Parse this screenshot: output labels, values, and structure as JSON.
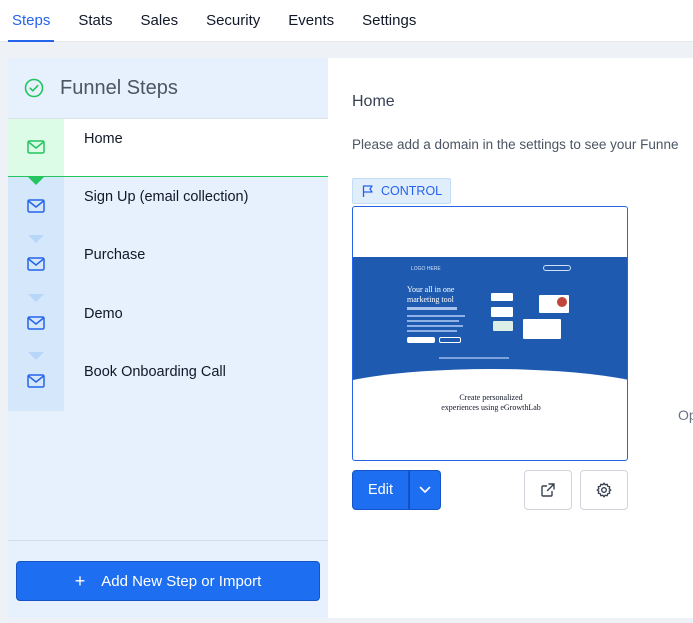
{
  "tabs": [
    {
      "label": "Steps",
      "active": true
    },
    {
      "label": "Stats",
      "active": false
    },
    {
      "label": "Sales",
      "active": false
    },
    {
      "label": "Security",
      "active": false
    },
    {
      "label": "Events",
      "active": false
    },
    {
      "label": "Settings",
      "active": false
    }
  ],
  "sidebar": {
    "title": "Funnel Steps",
    "steps": [
      {
        "label": "Home",
        "icon": "mail-icon",
        "active": true
      },
      {
        "label": "Sign Up (email collection)",
        "icon": "mail-icon",
        "active": false
      },
      {
        "label": "Purchase",
        "icon": "mail-icon",
        "active": false
      },
      {
        "label": "Demo",
        "icon": "mail-icon",
        "active": false
      },
      {
        "label": "Book Onboarding Call",
        "icon": "mail-icon",
        "active": false
      }
    ],
    "add_button": "Add New Step or Import"
  },
  "detail": {
    "step_title": "Home",
    "domain_message": "Please add a domain in the settings to see your Funne",
    "badge": "CONTROL",
    "preview": {
      "logo": "LOGO HERE",
      "headline_line1": "Your all in one",
      "headline_line2": "marketing tool",
      "caption_line1": "Create personalized",
      "caption_line2": "experiences using eGrowthLab"
    },
    "edit_label": "Edit",
    "side_text": "Op"
  },
  "colors": {
    "primary": "#1d6ef0",
    "tab_active": "#2563eb",
    "success": "#22c55e",
    "sidebar_bg": "#e6f1fd",
    "hero_bg": "#1e5bb0"
  }
}
